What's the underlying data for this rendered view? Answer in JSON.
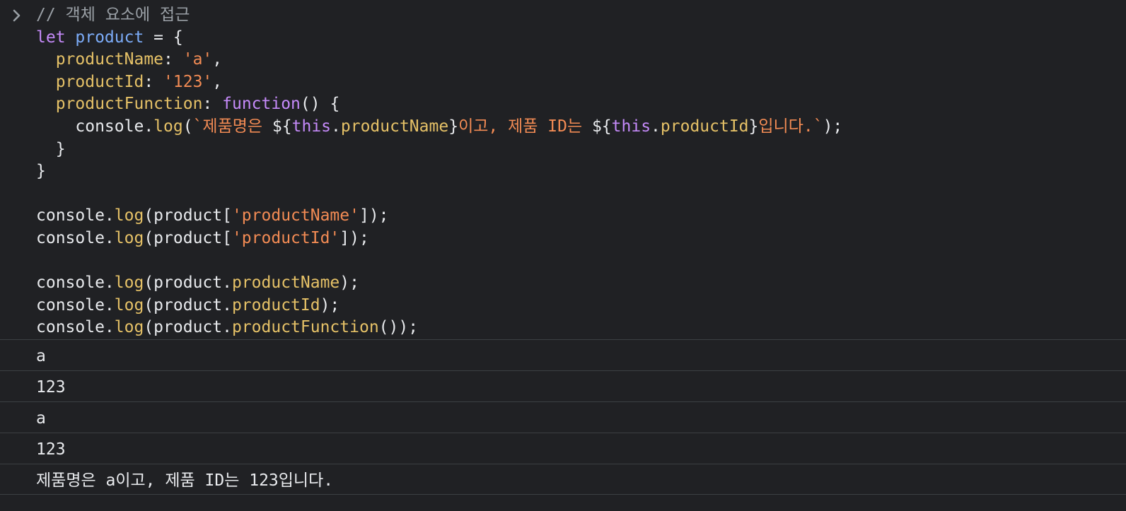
{
  "console": {
    "input_lines": [
      [
        {
          "t": "// 객체 요소에 접근",
          "c": "cmt"
        }
      ],
      [
        {
          "t": "let ",
          "c": "kw"
        },
        {
          "t": "product",
          "c": "var"
        },
        {
          "t": " = {",
          "c": "pun"
        }
      ],
      [
        {
          "t": "  ",
          "c": "pun"
        },
        {
          "t": "productName",
          "c": "prop"
        },
        {
          "t": ": ",
          "c": "pun"
        },
        {
          "t": "'a'",
          "c": "str"
        },
        {
          "t": ",",
          "c": "pun"
        }
      ],
      [
        {
          "t": "  ",
          "c": "pun"
        },
        {
          "t": "productId",
          "c": "prop"
        },
        {
          "t": ": ",
          "c": "pun"
        },
        {
          "t": "'123'",
          "c": "str"
        },
        {
          "t": ",",
          "c": "pun"
        }
      ],
      [
        {
          "t": "  ",
          "c": "pun"
        },
        {
          "t": "productFunction",
          "c": "prop"
        },
        {
          "t": ": ",
          "c": "pun"
        },
        {
          "t": "function",
          "c": "kw"
        },
        {
          "t": "() {",
          "c": "pun"
        }
      ],
      [
        {
          "t": "    console.",
          "c": "pun"
        },
        {
          "t": "log",
          "c": "prop"
        },
        {
          "t": "(",
          "c": "pun"
        },
        {
          "t": "`제품명은 ",
          "c": "str"
        },
        {
          "t": "${",
          "c": "pun"
        },
        {
          "t": "this",
          "c": "kw"
        },
        {
          "t": ".",
          "c": "pun"
        },
        {
          "t": "productName",
          "c": "prop"
        },
        {
          "t": "}",
          "c": "pun"
        },
        {
          "t": "이고, 제품 ID는 ",
          "c": "str"
        },
        {
          "t": "${",
          "c": "pun"
        },
        {
          "t": "this",
          "c": "kw"
        },
        {
          "t": ".",
          "c": "pun"
        },
        {
          "t": "productId",
          "c": "prop"
        },
        {
          "t": "}",
          "c": "pun"
        },
        {
          "t": "입니다.`",
          "c": "str"
        },
        {
          "t": ");",
          "c": "pun"
        }
      ],
      [
        {
          "t": "  }",
          "c": "pun"
        }
      ],
      [
        {
          "t": "}",
          "c": "pun"
        }
      ],
      [
        {
          "t": "",
          "c": "pun"
        }
      ],
      [
        {
          "t": "console.",
          "c": "pun"
        },
        {
          "t": "log",
          "c": "prop"
        },
        {
          "t": "(product[",
          "c": "pun"
        },
        {
          "t": "'productName'",
          "c": "str"
        },
        {
          "t": "]);",
          "c": "pun"
        }
      ],
      [
        {
          "t": "console.",
          "c": "pun"
        },
        {
          "t": "log",
          "c": "prop"
        },
        {
          "t": "(product[",
          "c": "pun"
        },
        {
          "t": "'productId'",
          "c": "str"
        },
        {
          "t": "]);",
          "c": "pun"
        }
      ],
      [
        {
          "t": "",
          "c": "pun"
        }
      ],
      [
        {
          "t": "console.",
          "c": "pun"
        },
        {
          "t": "log",
          "c": "prop"
        },
        {
          "t": "(product.",
          "c": "pun"
        },
        {
          "t": "productName",
          "c": "prop"
        },
        {
          "t": ");",
          "c": "pun"
        }
      ],
      [
        {
          "t": "console.",
          "c": "pun"
        },
        {
          "t": "log",
          "c": "prop"
        },
        {
          "t": "(product.",
          "c": "pun"
        },
        {
          "t": "productId",
          "c": "prop"
        },
        {
          "t": ");",
          "c": "pun"
        }
      ],
      [
        {
          "t": "console.",
          "c": "pun"
        },
        {
          "t": "log",
          "c": "prop"
        },
        {
          "t": "(product.",
          "c": "pun"
        },
        {
          "t": "productFunction",
          "c": "prop"
        },
        {
          "t": "());",
          "c": "pun"
        }
      ]
    ],
    "outputs": [
      "a",
      "123",
      "a",
      "123",
      "제품명은 a이고, 제품 ID는 123입니다."
    ],
    "icons": {
      "prompt": "chevron-right-icon"
    },
    "colors": {
      "background": "#202124",
      "text": "#e8eaed",
      "keyword": "#c58af9",
      "variable": "#7cacf8",
      "property": "#e5c167",
      "string": "#f28b54",
      "comment": "#9aa0a6",
      "divider": "#3c4043"
    }
  }
}
